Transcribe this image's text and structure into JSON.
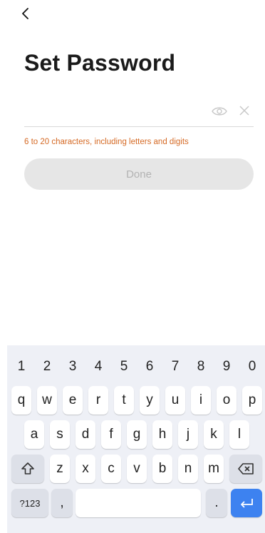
{
  "header": {
    "back_icon": "chevron-left-icon"
  },
  "title": "Set Password",
  "password": {
    "value": "",
    "placeholder": "",
    "eye_icon": "eye-icon",
    "clear_icon": "close-icon"
  },
  "hint": "6 to 20 characters, including letters and digits",
  "done_label": "Done",
  "keyboard": {
    "numbers": [
      "1",
      "2",
      "3",
      "4",
      "5",
      "6",
      "7",
      "8",
      "9",
      "0"
    ],
    "row1": [
      "q",
      "w",
      "e",
      "r",
      "t",
      "y",
      "u",
      "i",
      "o",
      "p"
    ],
    "row2": [
      "a",
      "s",
      "d",
      "f",
      "g",
      "h",
      "j",
      "k",
      "l"
    ],
    "row3": [
      "z",
      "x",
      "c",
      "v",
      "b",
      "n",
      "m"
    ],
    "symbols_label": "?123",
    "comma": ",",
    "period": ".",
    "space_label": "",
    "shift_icon": "shift-icon",
    "backspace_icon": "backspace-icon",
    "enter_icon": "enter-icon"
  },
  "colors": {
    "hint": "#d56a25",
    "enter_key": "#3d82f0",
    "done_bg": "#e6e6e6",
    "done_text": "#b3b3b3"
  }
}
